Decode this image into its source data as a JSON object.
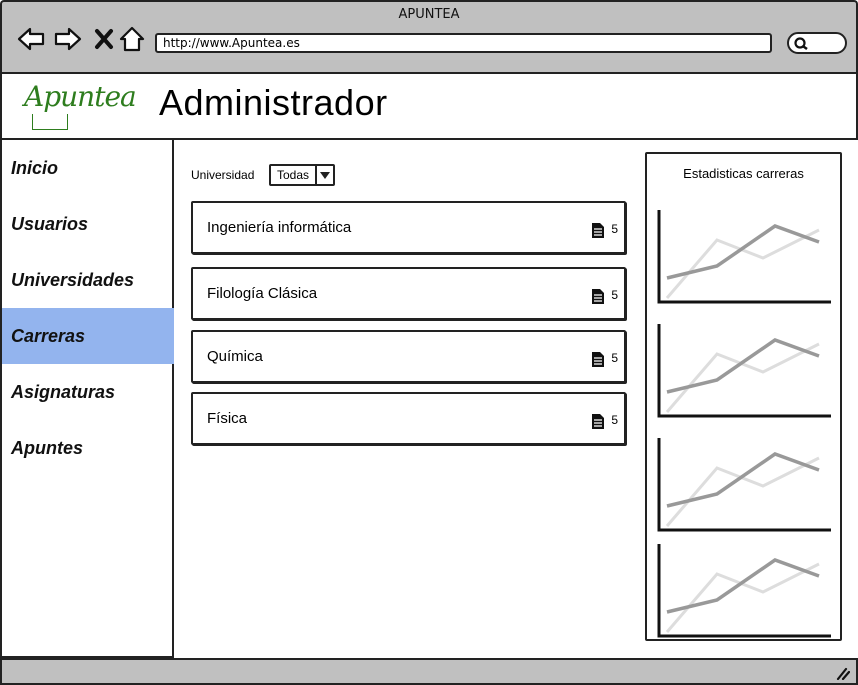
{
  "window": {
    "title": "APUNTEA",
    "url": "http://www.Apuntea.es"
  },
  "header": {
    "logo": "Apuntea",
    "title": "Administrador"
  },
  "sidebar": {
    "items": [
      {
        "label": "Inicio",
        "active": false
      },
      {
        "label": "Usuarios",
        "active": false
      },
      {
        "label": "Universidades",
        "active": false
      },
      {
        "label": "Carreras",
        "active": true
      },
      {
        "label": "Asignaturas",
        "active": false
      },
      {
        "label": "Apuntes",
        "active": false
      }
    ]
  },
  "filter": {
    "label": "Universidad",
    "selected": "Todas"
  },
  "careers": [
    {
      "name": "Ingeniería informática",
      "count": "5"
    },
    {
      "name": "Filología Clásica",
      "count": "5"
    },
    {
      "name": "Química",
      "count": "5"
    },
    {
      "name": "Física",
      "count": "5"
    }
  ],
  "stats": {
    "title": "Estadisticas carreras"
  },
  "colors": {
    "accent": "#93b4ee",
    "logo": "#2e7d1e",
    "chrome": "#c0c0c0"
  },
  "icons": [
    "back-arrow-icon",
    "forward-arrow-icon",
    "close-icon",
    "home-icon",
    "search-icon",
    "document-icon",
    "resize-grip-icon"
  ]
}
